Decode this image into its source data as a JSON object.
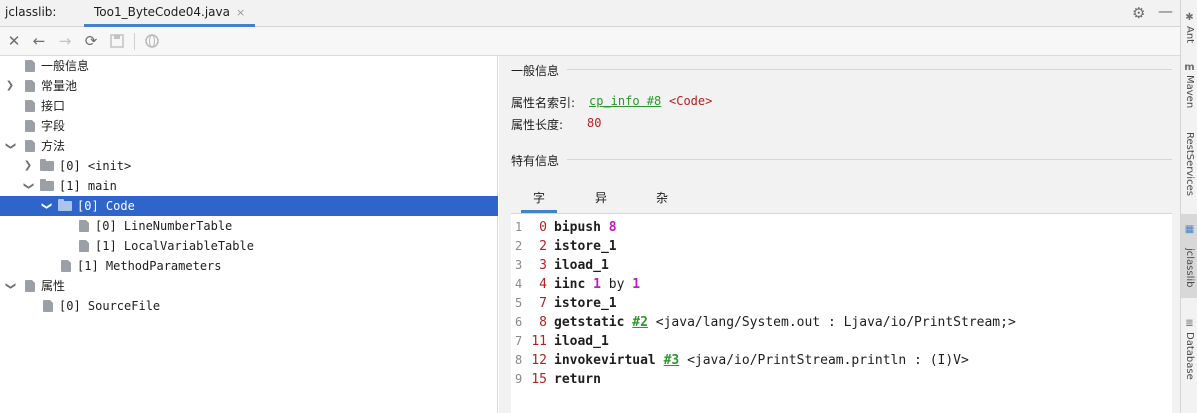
{
  "title_bar": {
    "app_label": "jclasslib:",
    "file_tab": "Too1_ByteCode04.java",
    "close_glyph": "×"
  },
  "toolbar": {
    "icons": [
      "close-icon",
      "back-icon",
      "forward-icon",
      "refresh-icon",
      "save-icon",
      "browser-icon"
    ]
  },
  "tree": {
    "items": [
      {
        "label": "一般信息"
      },
      {
        "label": "常量池"
      },
      {
        "label": "接口"
      },
      {
        "label": "字段"
      },
      {
        "label": "方法"
      },
      {
        "label": "[0] <init>"
      },
      {
        "label": "[1] main"
      },
      {
        "label": "[0] Code"
      },
      {
        "label": "[0] LineNumberTable"
      },
      {
        "label": "[1] LocalVariableTable"
      },
      {
        "label": "[1] MethodParameters"
      },
      {
        "label": "属性"
      },
      {
        "label": "[0] SourceFile"
      }
    ]
  },
  "general": {
    "section_title": "一般信息",
    "name_index_label": "属性名索引:",
    "name_index_link": "cp_info #8",
    "name_index_extra": "<Code>",
    "length_label": "属性长度:",
    "length_value": "80"
  },
  "specific": {
    "section_title": "特有信息",
    "tabs": [
      "字节码",
      "异常表",
      "杂项"
    ]
  },
  "code_lines": [
    {
      "line": "1",
      "offset": "0",
      "op": "bipush",
      "arg": "8",
      "ref": "",
      "comment": ""
    },
    {
      "line": "2",
      "offset": "2",
      "op": "istore_1",
      "arg": "",
      "ref": "",
      "comment": ""
    },
    {
      "line": "3",
      "offset": "3",
      "op": "iload_1",
      "arg": "",
      "ref": "",
      "comment": ""
    },
    {
      "line": "4",
      "offset": "4",
      "op": "iinc",
      "arg": "1",
      "by": "by",
      "arg2": "1",
      "ref": "",
      "comment": ""
    },
    {
      "line": "5",
      "offset": "7",
      "op": "istore_1",
      "arg": "",
      "ref": "",
      "comment": ""
    },
    {
      "line": "6",
      "offset": "8",
      "op": "getstatic",
      "arg": "",
      "ref": "#2",
      "comment": "<java/lang/System.out : Ljava/io/PrintStream;>"
    },
    {
      "line": "7",
      "offset": "11",
      "op": "iload_1",
      "arg": "",
      "ref": "",
      "comment": ""
    },
    {
      "line": "8",
      "offset": "12",
      "op": "invokevirtual",
      "arg": "",
      "ref": "#3",
      "comment": "<java/io/PrintStream.println : (I)V>"
    },
    {
      "line": "9",
      "offset": "15",
      "op": "return",
      "arg": "",
      "ref": "",
      "comment": ""
    }
  ],
  "side_strip": {
    "items": [
      "Ant",
      "Maven",
      "RestServices",
      "jclasslib",
      "Database"
    ]
  },
  "colors": {
    "selection": "#2f65ca",
    "accent": "#4083c9",
    "link_green": "#2a9a2a",
    "number_red": "#b22222",
    "arg_magenta": "#c518c5"
  }
}
